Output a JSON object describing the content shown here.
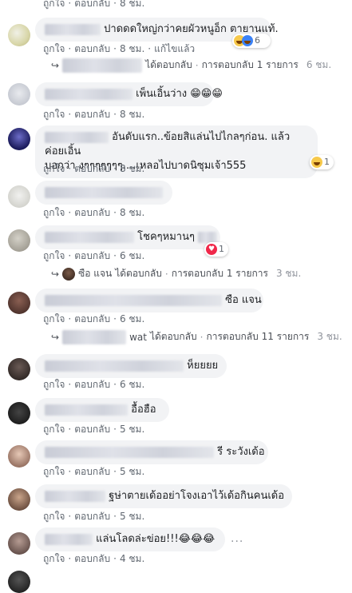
{
  "meta": {
    "like": "ถูกใจ",
    "reply": "ตอบกลับ",
    "edited": "แก้ไขแล้ว"
  },
  "comments": [
    {
      "text": "ปาดดดใหญ่กว่าคยผัวหนูอ็ก ตายานแท้.",
      "time": "8 ชม.",
      "reaction_count": "6"
    },
    {
      "text": "เพ็นเอิ้นว่าง 😁😁😁",
      "time": "8 ชม."
    },
    {
      "text_line1": "อันดับแรก..ข้อยสิแล่นไปไกลๆก่อน. แล้วค่อยเอิ้น",
      "text_line2": "บอกว่า งๆๆๆๆๆๆๆ....เหลอไปบาดนิซุมเจ้า555",
      "time": "8 ชม.",
      "reaction_count": "1"
    },
    {
      "time": "8 ชม."
    },
    {
      "text": "โชคๆหมานๆ",
      "time": "6 ชม.",
      "reaction_count": "1"
    },
    {
      "text": "ซือ แจน",
      "time": "6 ชม."
    },
    {
      "text": "ห็ยยยย",
      "time": "6 ชม."
    },
    {
      "text": "อื้อฮือ",
      "time": "5 ชม."
    },
    {
      "text": "รี ระวังเด้อ",
      "time": "5 ชม."
    },
    {
      "text": "ฐษ่าตายเด้ออย่าโจงเอาไว้เด้อกินคนเด้อ",
      "time": "5 ชม."
    },
    {
      "text": "แล่นโลดล่ะข่อย!!!😂😂😂",
      "time": "4 ชม."
    }
  ],
  "replies": [
    {
      "action": "ได้ตอบกลับ",
      "count_text": "การตอบกลับ 1 รายการ",
      "time": "6 ชม."
    },
    {
      "name": "ซือ แจน",
      "action": "ได้ตอบกลับ",
      "count_text": "การตอบกลับ 1 รายการ",
      "time": "3 ชม."
    },
    {
      "name_suffix": "wat",
      "action": "ได้ตอบกลับ",
      "count_text": "การตอบกลับ 11 รายการ",
      "time": "3 ชม."
    }
  ],
  "colors": {
    "bubble": "#f2f3f5",
    "meta": "#606770",
    "heart": "#f0284a",
    "emoji": "#f7c94b"
  }
}
